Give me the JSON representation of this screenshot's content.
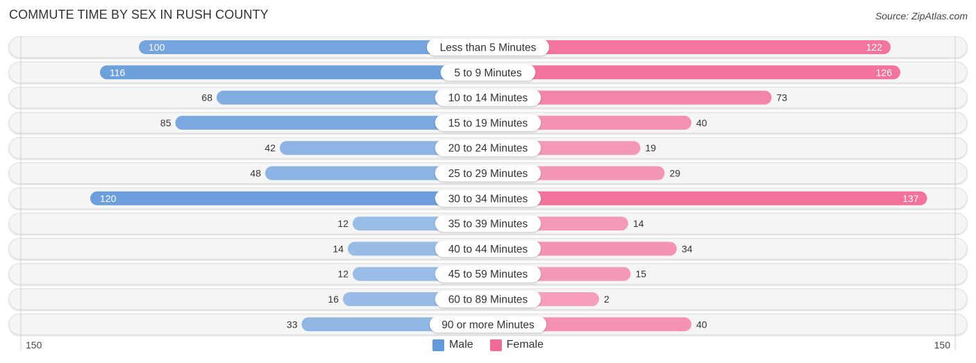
{
  "title": "COMMUTE TIME BY SEX IN RUSH COUNTY",
  "source": "Source: ZipAtlas.com",
  "legend": [
    {
      "name": "Male",
      "color": "#6399d9"
    },
    {
      "name": "Female",
      "color": "#f26a96"
    }
  ],
  "axis": {
    "left_label": "150",
    "right_label": "150"
  },
  "chart_data": {
    "type": "bar",
    "orientation": "horizontal-diverging",
    "title": "COMMUTE TIME BY SEX IN RUSH COUNTY",
    "xlabel": "",
    "ylabel": "",
    "xlim": [
      -150,
      150
    ],
    "legend_position": "bottom",
    "categories": [
      "Less than 5 Minutes",
      "5 to 9 Minutes",
      "10 to 14 Minutes",
      "15 to 19 Minutes",
      "20 to 24 Minutes",
      "25 to 29 Minutes",
      "30 to 34 Minutes",
      "35 to 39 Minutes",
      "40 to 44 Minutes",
      "45 to 59 Minutes",
      "60 to 89 Minutes",
      "90 or more Minutes"
    ],
    "series": [
      {
        "name": "Male",
        "side": "left",
        "values": [
          100,
          116,
          68,
          85,
          42,
          48,
          120,
          12,
          14,
          12,
          16,
          33
        ]
      },
      {
        "name": "Female",
        "side": "right",
        "values": [
          122,
          126,
          73,
          40,
          19,
          29,
          137,
          14,
          34,
          15,
          2,
          40
        ]
      }
    ],
    "tick_labels": [
      "150",
      "150"
    ]
  }
}
